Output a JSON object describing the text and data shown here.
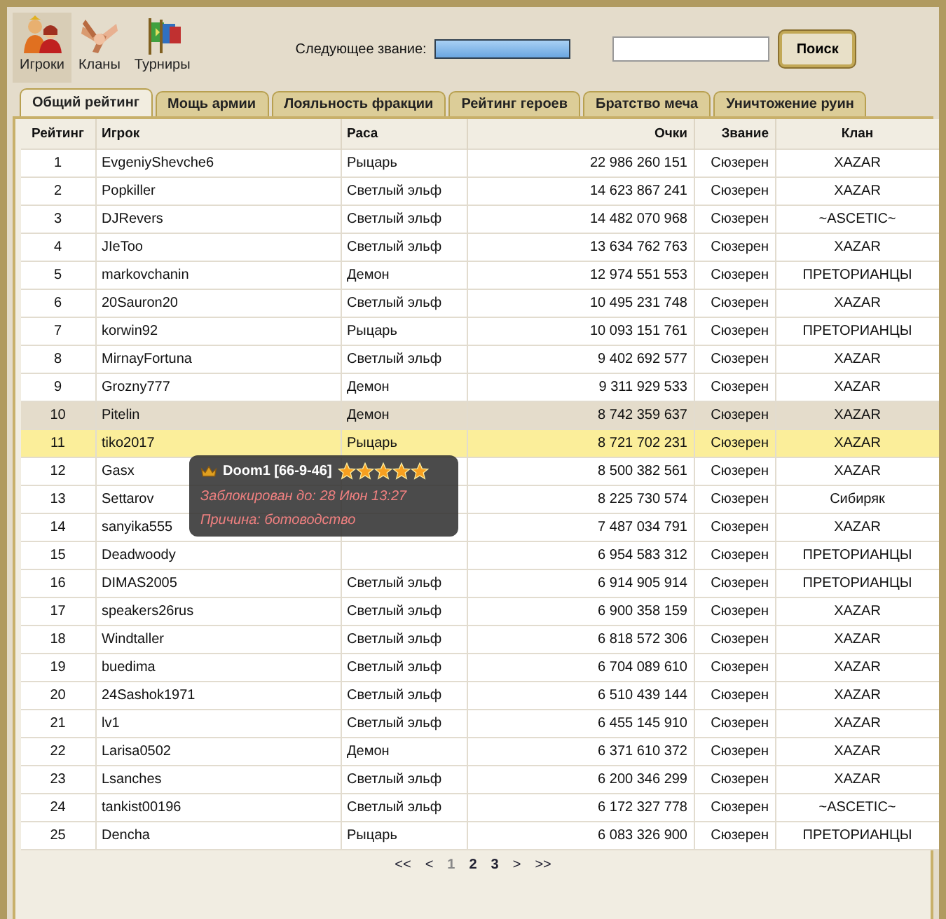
{
  "nav": [
    {
      "label": "Игроки",
      "selected": true
    },
    {
      "label": "Кланы",
      "selected": false
    },
    {
      "label": "Турниры",
      "selected": false
    }
  ],
  "next_rank": {
    "label": "Следующее звание:",
    "level": 1
  },
  "search": {
    "button": "Поиск"
  },
  "tabs": [
    {
      "label": "Общий рейтинг",
      "selected": true
    },
    {
      "label": "Мощь армии",
      "selected": false
    },
    {
      "label": "Лояльность фракции",
      "selected": false
    },
    {
      "label": "Рейтинг героев",
      "selected": false
    },
    {
      "label": "Братство меча",
      "selected": false
    },
    {
      "label": "Уничтожение руин",
      "selected": false
    }
  ],
  "table": {
    "columns": [
      "Рейтинг",
      "Игрок",
      "Раса",
      "Очки",
      "Звание",
      "Клан"
    ],
    "rows": [
      {
        "cells": [
          "1",
          "EvgeniyShevche6",
          "Рыцарь",
          "22 986 260 151",
          "Сюзерен",
          "XAZAR"
        ],
        "hovered": false,
        "selected": false
      },
      {
        "cells": [
          "2",
          "Popkiller",
          "Светлый эльф",
          "14 623 867 241",
          "Сюзерен",
          "XAZAR"
        ],
        "hovered": false,
        "selected": false
      },
      {
        "cells": [
          "3",
          "DJRevers",
          "Светлый эльф",
          "14 482 070 968",
          "Сюзерен",
          "~ASCETIC~"
        ],
        "hovered": false,
        "selected": false
      },
      {
        "cells": [
          "4",
          "JIeToo",
          "Светлый эльф",
          "13 634 762 763",
          "Сюзерен",
          "XAZAR"
        ],
        "hovered": false,
        "selected": false
      },
      {
        "cells": [
          "5",
          "markovchanin",
          "Демон",
          "12 974 551 553",
          "Сюзерен",
          "ПРЕТОРИАНЦЫ"
        ],
        "hovered": false,
        "selected": false
      },
      {
        "cells": [
          "6",
          "20Sauron20",
          "Светлый эльф",
          "10 495 231 748",
          "Сюзерен",
          "XAZAR"
        ],
        "hovered": false,
        "selected": false
      },
      {
        "cells": [
          "7",
          "korwin92",
          "Рыцарь",
          "10 093 151 761",
          "Сюзерен",
          "ПРЕТОРИАНЦЫ"
        ],
        "hovered": false,
        "selected": false
      },
      {
        "cells": [
          "8",
          "MirnayFortuna",
          "Светлый эльф",
          "9 402 692 577",
          "Сюзерен",
          "XAZAR"
        ],
        "hovered": false,
        "selected": false
      },
      {
        "cells": [
          "9",
          "Grozny777",
          "Демон",
          "9 311 929 533",
          "Сюзерен",
          "XAZAR"
        ],
        "hovered": false,
        "selected": false
      },
      {
        "cells": [
          "10",
          "Pitelin",
          "Демон",
          "8 742 359 637",
          "Сюзерен",
          "XAZAR"
        ],
        "hovered": true,
        "selected": false
      },
      {
        "cells": [
          "11",
          "tiko2017",
          "Рыцарь",
          "8 721 702 231",
          "Сюзерен",
          "XAZAR"
        ],
        "hovered": false,
        "selected": true
      },
      {
        "cells": [
          "12",
          "Gasx",
          null,
          "8 500 382 561",
          "Сюзерен",
          "XAZAR"
        ],
        "hovered": false,
        "selected": false
      },
      {
        "cells": [
          "13",
          "Settarov",
          null,
          "8 225 730 574",
          "Сюзерен",
          "Сибиряк"
        ],
        "hovered": false,
        "selected": false
      },
      {
        "cells": [
          "14",
          "sanyika555",
          null,
          "7 487 034 791",
          "Сюзерен",
          "XAZAR"
        ],
        "hovered": false,
        "selected": false
      },
      {
        "cells": [
          "15",
          "Deadwoody",
          null,
          "6 954 583 312",
          "Сюзерен",
          "ПРЕТОРИАНЦЫ"
        ],
        "hovered": false,
        "selected": false
      },
      {
        "cells": [
          "16",
          "DIMAS2005",
          "Светлый эльф",
          "6 914 905 914",
          "Сюзерен",
          "ПРЕТОРИАНЦЫ"
        ],
        "hovered": false,
        "selected": false
      },
      {
        "cells": [
          "17",
          "speakers26rus",
          "Светлый эльф",
          "6 900 358 159",
          "Сюзерен",
          "XAZAR"
        ],
        "hovered": false,
        "selected": false
      },
      {
        "cells": [
          "18",
          "Windtaller",
          "Светлый эльф",
          "6 818 572 306",
          "Сюзерен",
          "XAZAR"
        ],
        "hovered": false,
        "selected": false
      },
      {
        "cells": [
          "19",
          "buedima",
          "Светлый эльф",
          "6 704 089 610",
          "Сюзерен",
          "XAZAR"
        ],
        "hovered": false,
        "selected": false
      },
      {
        "cells": [
          "20",
          "24Sashok1971",
          "Светлый эльф",
          "6 510 439 144",
          "Сюзерен",
          "XAZAR"
        ],
        "hovered": false,
        "selected": false
      },
      {
        "cells": [
          "21",
          "lv1",
          "Светлый эльф",
          "6 455 145 910",
          "Сюзерен",
          "XAZAR"
        ],
        "hovered": false,
        "selected": false
      },
      {
        "cells": [
          "22",
          "Larisa0502",
          "Демон",
          "6 371 610 372",
          "Сюзерен",
          "XAZAR"
        ],
        "hovered": false,
        "selected": false
      },
      {
        "cells": [
          "23",
          "Lsanches",
          "Светлый эльф",
          "6 200 346 299",
          "Сюзерен",
          "XAZAR"
        ],
        "hovered": false,
        "selected": false
      },
      {
        "cells": [
          "24",
          "tankist00196",
          "Светлый эльф",
          "6 172 327 778",
          "Сюзерен",
          "~ASCETIC~"
        ],
        "hovered": false,
        "selected": false
      },
      {
        "cells": [
          "25",
          "Dencha",
          "Рыцарь",
          "6 083 326 900",
          "Сюзерен",
          "ПРЕТОРИАНЦЫ"
        ],
        "hovered": false,
        "selected": false
      }
    ]
  },
  "tooltip": {
    "title": "Doom1 [66-9-46]",
    "stars": 5,
    "lines": [
      "Заблокирован до: 28 Июн 13:27",
      "Причина: ботоводство"
    ]
  },
  "pagination": [
    {
      "label": "<<",
      "kind": "arrow",
      "current": false
    },
    {
      "label": "<",
      "kind": "arrow",
      "current": false
    },
    {
      "label": "1",
      "kind": "page",
      "current": true
    },
    {
      "label": "2",
      "kind": "page",
      "current": false
    },
    {
      "label": "3",
      "kind": "page",
      "current": false
    },
    {
      "label": ">",
      "kind": "arrow",
      "current": false
    },
    {
      "label": ">>",
      "kind": "arrow",
      "current": false
    }
  ]
}
